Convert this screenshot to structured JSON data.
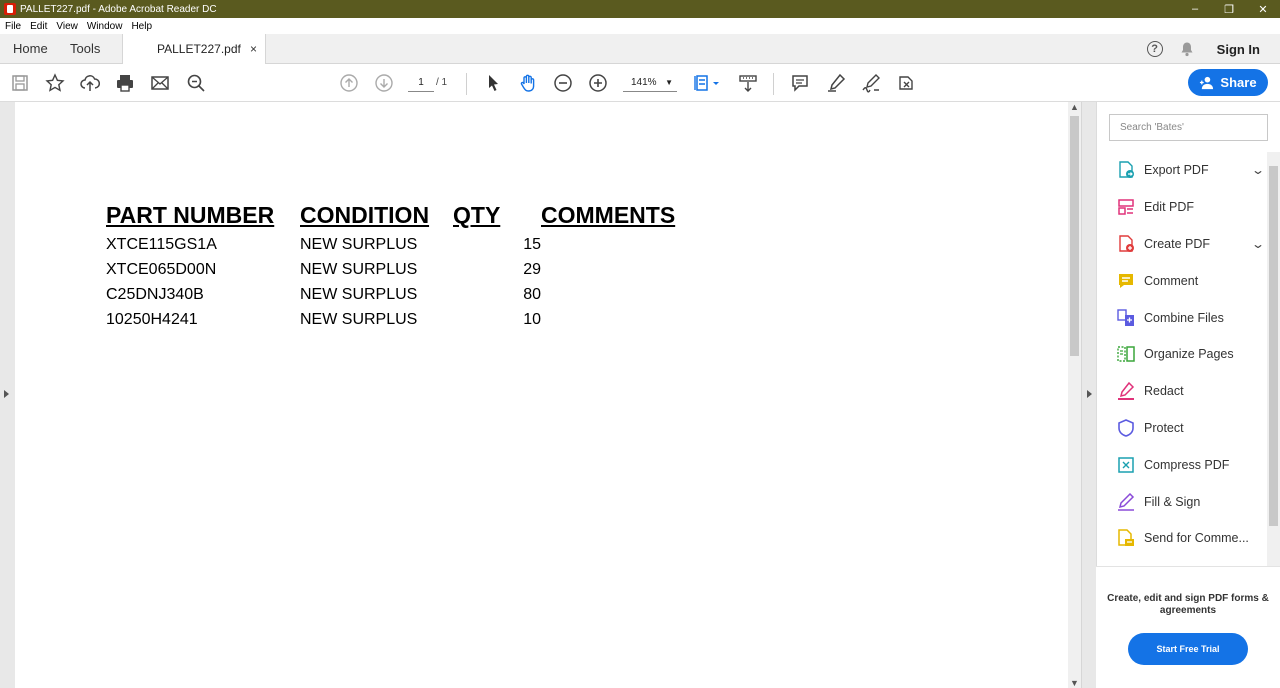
{
  "window": {
    "title": "PALLET227.pdf - Adobe Acrobat Reader DC",
    "controls": [
      "–",
      "❐",
      "✕"
    ]
  },
  "menu": [
    "File",
    "Edit",
    "View",
    "Window",
    "Help"
  ],
  "tabs": {
    "home": "Home",
    "tools": "Tools",
    "document": "PALLET227.pdf",
    "close": "×"
  },
  "header_right": {
    "help": "?",
    "sign_in": "Sign In"
  },
  "toolbar": {
    "page_current": "1",
    "page_total": "/ 1",
    "zoom": "141%",
    "share_label": "Share",
    "icons": [
      "save-icon",
      "bookmark-star-icon",
      "upload-cloud-icon",
      "print-icon",
      "email-icon",
      "zoom-search-icon",
      "page-up-icon",
      "page-down-icon",
      "select-cursor-icon",
      "hand-tool-icon",
      "zoom-out-icon",
      "zoom-in-icon",
      "page-fit-icon",
      "read-mode-icon",
      "comment-icon",
      "highlight-pen-icon",
      "sign-icon",
      "more-tools-icon"
    ]
  },
  "document": {
    "headers": [
      "PART NUMBER",
      "CONDITION",
      "QTY",
      "COMMENTS"
    ],
    "rows": [
      [
        "XTCE115GS1A",
        "NEW SURPLUS",
        "15",
        ""
      ],
      [
        "XTCE065D00N",
        "NEW SURPLUS",
        "29",
        ""
      ],
      [
        "C25DNJ340B",
        "NEW SURPLUS",
        "80",
        ""
      ],
      [
        "10250H4241",
        "NEW SURPLUS",
        "10",
        ""
      ]
    ]
  },
  "right_pane": {
    "search_placeholder": "Search 'Bates'",
    "tools": [
      {
        "label": "Export PDF",
        "icon": "export-pdf-icon",
        "color": "#1aa0b0"
      },
      {
        "label": "Edit PDF",
        "icon": "edit-pdf-icon",
        "color": "#e0327a"
      },
      {
        "label": "Create PDF",
        "icon": "create-pdf-icon",
        "color": "#e03c3c"
      },
      {
        "label": "Comment",
        "icon": "comment-tool-icon",
        "color": "#e6b800"
      },
      {
        "label": "Combine Files",
        "icon": "combine-files-icon",
        "color": "#5b5be0"
      },
      {
        "label": "Organize Pages",
        "icon": "organize-pages-icon",
        "color": "#3aa63a"
      },
      {
        "label": "Redact",
        "icon": "redact-icon",
        "color": "#e0327a"
      },
      {
        "label": "Protect",
        "icon": "protect-icon",
        "color": "#5b5be0"
      },
      {
        "label": "Compress PDF",
        "icon": "compress-pdf-icon",
        "color": "#1aa0b0"
      },
      {
        "label": "Fill & Sign",
        "icon": "fill-sign-icon",
        "color": "#8a4ad8"
      },
      {
        "label": "Send for Comme...",
        "icon": "send-comment-icon",
        "color": "#e6b800"
      }
    ],
    "promo_text": "Create, edit and sign PDF forms & agreements",
    "trial_button": "Start Free Trial"
  },
  "colors": {
    "titlebar": "#5a5a1f",
    "accent": "#1473e6"
  }
}
